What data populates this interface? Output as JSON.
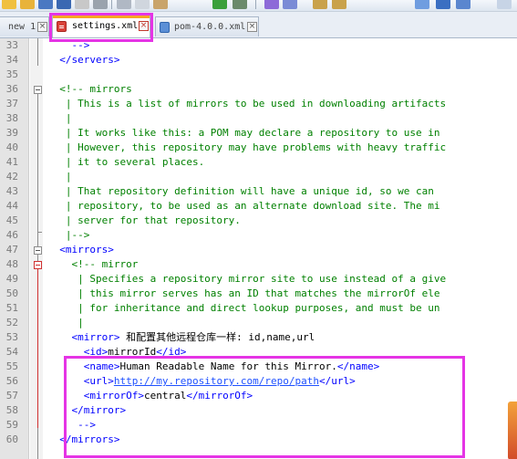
{
  "toolbar": {
    "icons": [
      "new-file-icon",
      "open-file-icon",
      "save-icon",
      "save-all-icon",
      "close-icon",
      "print-icon",
      "cut-icon",
      "copy-icon",
      "paste-icon",
      "undo-icon",
      "redo-icon",
      "find-icon",
      "replace-icon",
      "zoom-in-icon",
      "zoom-out-icon",
      "sync-scroll-icon",
      "word-wrap-icon",
      "indent-guide-icon",
      "macro-icon"
    ]
  },
  "tabs": [
    {
      "label": "new 1",
      "active": false
    },
    {
      "label": "settings.xml",
      "active": true
    },
    {
      "label": "pom-4.0.0.xml",
      "active": false
    }
  ],
  "close_glyph": "×",
  "editor": {
    "lines": [
      {
        "n": "33",
        "parts": [
          {
            "k": "t",
            "s": "    -->"
          }
        ]
      },
      {
        "n": "34",
        "parts": [
          {
            "k": "t",
            "s": "  </servers>"
          }
        ]
      },
      {
        "n": "35",
        "parts": []
      },
      {
        "n": "36",
        "parts": [
          {
            "k": "c",
            "s": "  <!-- mirrors"
          }
        ]
      },
      {
        "n": "37",
        "parts": [
          {
            "k": "c",
            "s": "   | This is a list of mirrors to be used in downloading artifacts"
          }
        ]
      },
      {
        "n": "38",
        "parts": [
          {
            "k": "c",
            "s": "   |"
          }
        ]
      },
      {
        "n": "39",
        "parts": [
          {
            "k": "c",
            "s": "   | It works like this: a POM may declare a repository to use in"
          }
        ]
      },
      {
        "n": "40",
        "parts": [
          {
            "k": "c",
            "s": "   | However, this repository may have problems with heavy traffic"
          }
        ]
      },
      {
        "n": "41",
        "parts": [
          {
            "k": "c",
            "s": "   | it to several places."
          }
        ]
      },
      {
        "n": "42",
        "parts": [
          {
            "k": "c",
            "s": "   |"
          }
        ]
      },
      {
        "n": "43",
        "parts": [
          {
            "k": "c",
            "s": "   | That repository definition will have a unique id, so we can"
          }
        ]
      },
      {
        "n": "44",
        "parts": [
          {
            "k": "c",
            "s": "   | repository, to be used as an alternate download site. The mi"
          }
        ]
      },
      {
        "n": "45",
        "parts": [
          {
            "k": "c",
            "s": "   | server for that repository."
          }
        ]
      },
      {
        "n": "46",
        "parts": [
          {
            "k": "c",
            "s": "   |-->"
          }
        ]
      },
      {
        "n": "47",
        "parts": [
          {
            "k": "t",
            "s": "  <mirrors>"
          }
        ]
      },
      {
        "n": "48",
        "parts": [
          {
            "k": "c",
            "s": "    <!-- mirror"
          }
        ]
      },
      {
        "n": "49",
        "parts": [
          {
            "k": "c",
            "s": "     | Specifies a repository mirror site to use instead of a give"
          }
        ]
      },
      {
        "n": "50",
        "parts": [
          {
            "k": "c",
            "s": "     | this mirror serves has an ID that matches the mirrorOf ele"
          }
        ]
      },
      {
        "n": "51",
        "parts": [
          {
            "k": "c",
            "s": "     | for inheritance and direct lookup purposes, and must be un"
          }
        ]
      },
      {
        "n": "52",
        "parts": [
          {
            "k": "c",
            "s": "     |"
          }
        ]
      },
      {
        "n": "53",
        "parts": [
          {
            "k": "t",
            "s": "    <mirror>"
          },
          {
            "k": "x",
            "s": " 和配置其他远程仓库一样: id,name,url"
          }
        ]
      },
      {
        "n": "54",
        "parts": [
          {
            "k": "t",
            "s": "      <id>"
          },
          {
            "k": "x",
            "s": "mirrorId"
          },
          {
            "k": "t",
            "s": "</id>"
          }
        ]
      },
      {
        "n": "55",
        "parts": [
          {
            "k": "t",
            "s": "      <name>"
          },
          {
            "k": "x",
            "s": "Human Readable Name for this Mirror."
          },
          {
            "k": "t",
            "s": "</name>"
          }
        ]
      },
      {
        "n": "56",
        "parts": [
          {
            "k": "t",
            "s": "      <url>"
          },
          {
            "k": "u",
            "s": "http://my.repository.com/repo/path"
          },
          {
            "k": "t",
            "s": "</url>"
          }
        ]
      },
      {
        "n": "57",
        "parts": [
          {
            "k": "t",
            "s": "      <mirrorOf>"
          },
          {
            "k": "x",
            "s": "central"
          },
          {
            "k": "t",
            "s": "</mirrorOf>"
          }
        ]
      },
      {
        "n": "58",
        "parts": [
          {
            "k": "t",
            "s": "    </mirror>"
          }
        ]
      },
      {
        "n": "59",
        "parts": [
          {
            "k": "t",
            "s": "     -->"
          }
        ]
      },
      {
        "n": "60",
        "parts": [
          {
            "k": "t",
            "s": "  </mirrors>"
          }
        ]
      }
    ]
  }
}
